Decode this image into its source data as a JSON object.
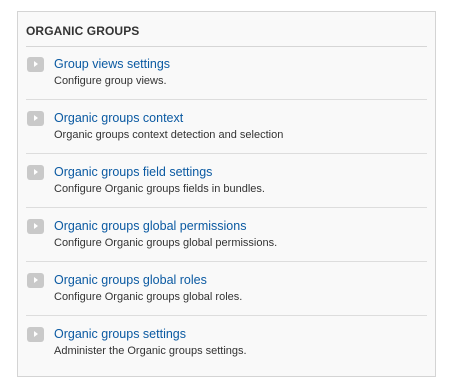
{
  "panel": {
    "title": "ORGANIC GROUPS",
    "items": [
      {
        "label": "Group views settings",
        "description": "Configure group views."
      },
      {
        "label": "Organic groups context",
        "description": "Organic groups context detection and selection"
      },
      {
        "label": "Organic groups field settings",
        "description": "Configure Organic groups fields in bundles."
      },
      {
        "label": "Organic groups global permissions",
        "description": "Configure Organic groups global permissions."
      },
      {
        "label": "Organic groups global roles",
        "description": "Configure Organic groups global roles."
      },
      {
        "label": "Organic groups settings",
        "description": "Administer the Organic groups settings."
      }
    ]
  },
  "colors": {
    "link": "#0b5aa2",
    "panel_background": "#f9f9f9",
    "arrow_background": "#c9c9c9"
  },
  "icons": {
    "item_arrow": "chevron-right-icon"
  }
}
